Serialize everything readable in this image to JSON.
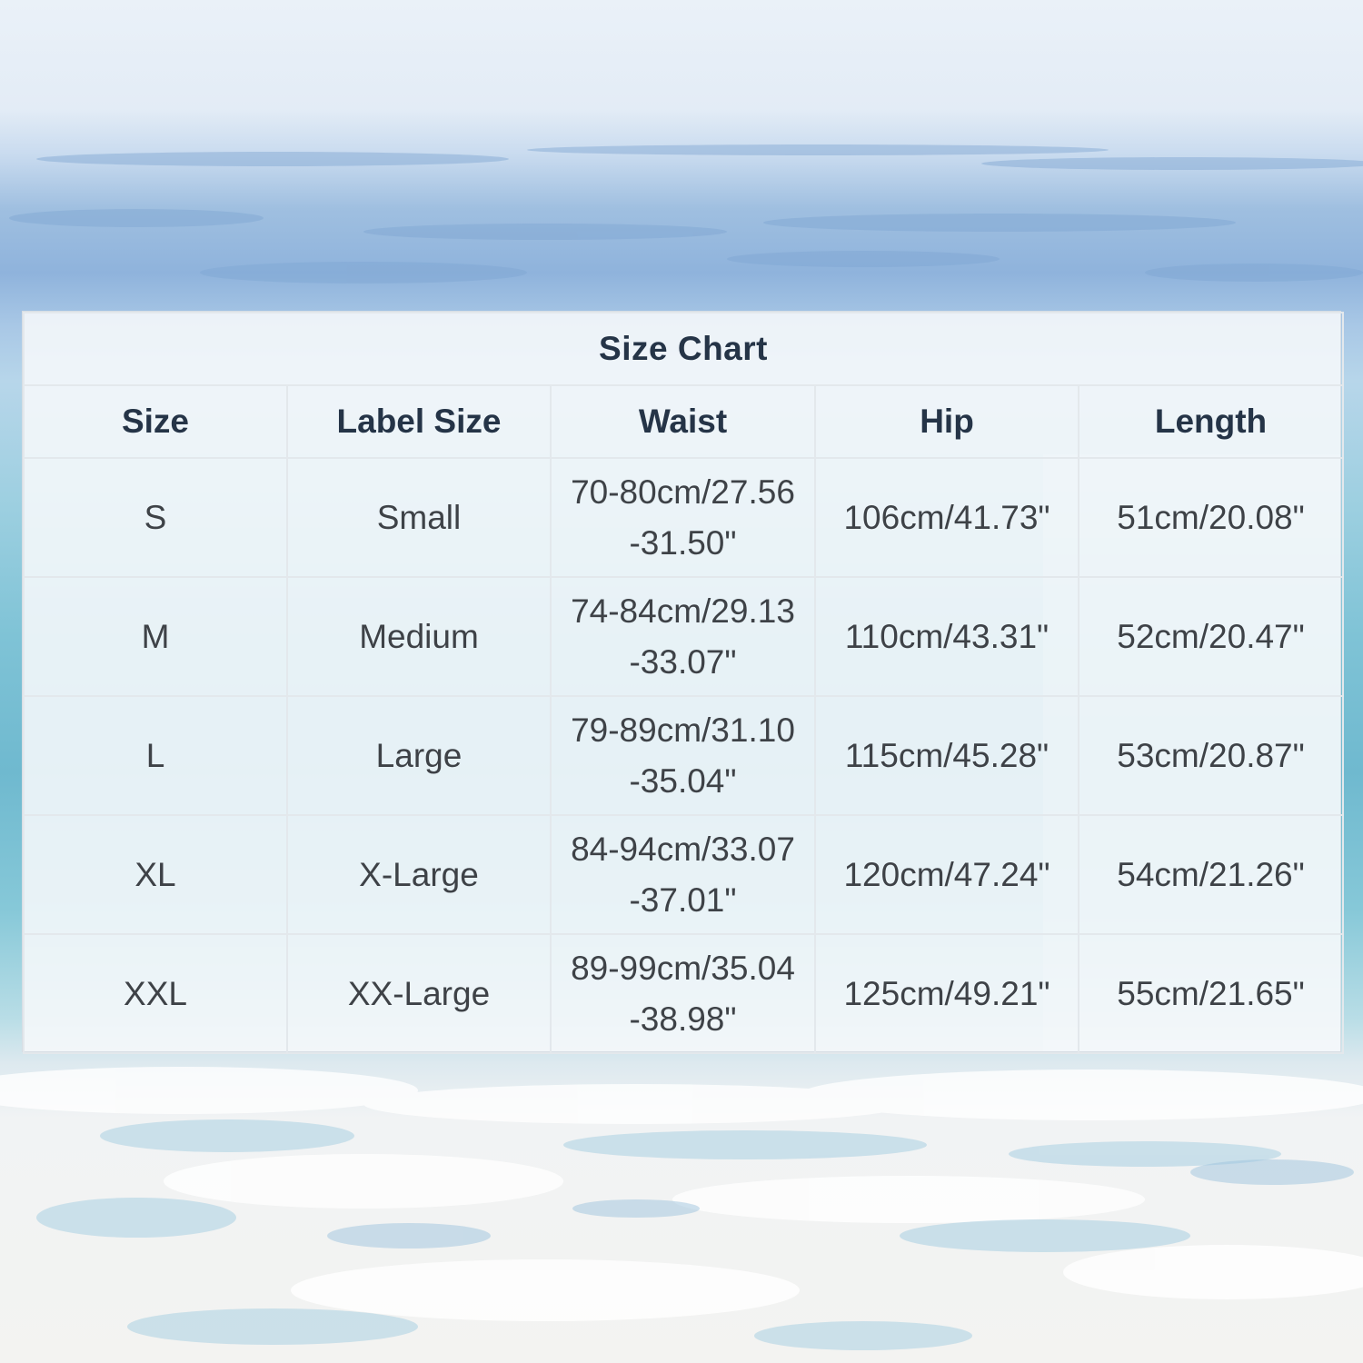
{
  "chart": {
    "title": "Size Chart",
    "headers": [
      "Size",
      "Label Size",
      "Waist",
      "Hip",
      "Length"
    ],
    "rows": [
      {
        "size": "S",
        "label": "Small",
        "waist": "70-80cm/27.56-31.50\"",
        "hip": "106cm/41.73\"",
        "length": "51cm/20.08\""
      },
      {
        "size": "M",
        "label": "Medium",
        "waist": "74-84cm/29.13-33.07\"",
        "hip": "110cm/43.31\"",
        "length": "52cm/20.47\""
      },
      {
        "size": "L",
        "label": "Large",
        "waist": "79-89cm/31.10-35.04\"",
        "hip": "115cm/45.28\"",
        "length": "53cm/20.87\""
      },
      {
        "size": "XL",
        "label": "X-Large",
        "waist": "84-94cm/33.07-37.01\"",
        "hip": "120cm/47.24\"",
        "length": "54cm/21.26\""
      },
      {
        "size": "XXL",
        "label": "XX-Large",
        "waist": "89-99cm/35.04-38.98\"",
        "hip": "125cm/49.21\"",
        "length": "55cm/21.65\""
      }
    ]
  },
  "colors": {
    "heading": "#253447",
    "body_text": "#3f4348",
    "grid": "#e3e8ec"
  }
}
